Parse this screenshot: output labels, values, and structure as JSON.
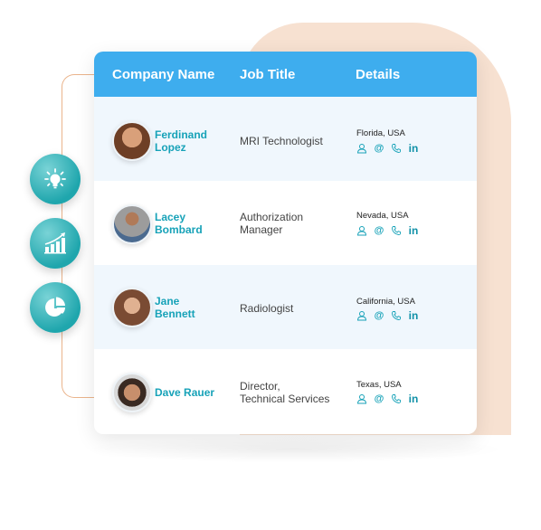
{
  "table": {
    "headers": {
      "company": "Company Name",
      "job": "Job Title",
      "details": "Details"
    },
    "rows": [
      {
        "name_line1": "Ferdinand",
        "name_line2": "Lopez",
        "job_line1": "MRI Technologist",
        "job_line2": "",
        "location": "Florida, USA"
      },
      {
        "name_line1": "Lacey",
        "name_line2": "Bombard",
        "job_line1": "Authorization",
        "job_line2": "Manager",
        "location": "Nevada, USA"
      },
      {
        "name_line1": "Jane",
        "name_line2": "Bennett",
        "job_line1": "Radiologist",
        "job_line2": "",
        "location": "California, USA"
      },
      {
        "name_line1": "Dave Rauer",
        "name_line2": "",
        "job_line1": "Director,",
        "job_line2": "Technical Services",
        "location": "Texas, USA"
      }
    ],
    "contact_icons": [
      "person-icon",
      "email-at-icon",
      "phone-icon",
      "linkedin-icon"
    ],
    "contact_glyphs": {
      "at": "@",
      "linkedin": "in"
    }
  },
  "side_icons": [
    "lightbulb-icon",
    "growth-chart-icon",
    "pie-chart-icon"
  ],
  "colors": {
    "header": "#3eadee",
    "accent_teal": "#17a2b8",
    "peach": "#f7e1d1",
    "bracket": "#eab48c"
  }
}
